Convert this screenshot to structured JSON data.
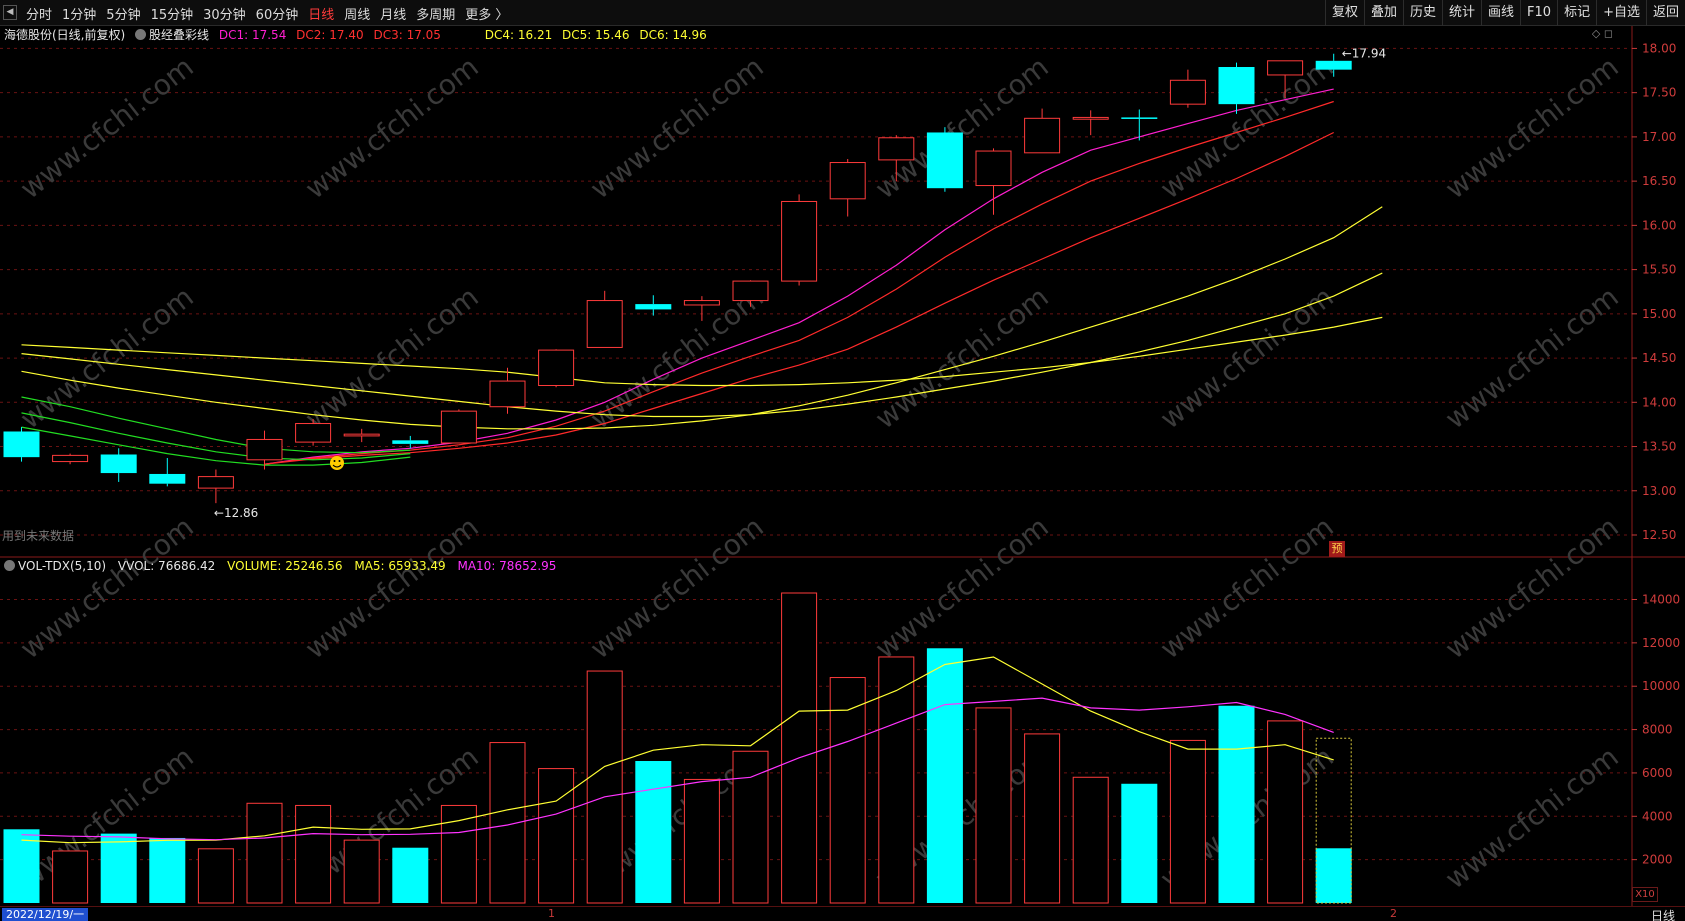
{
  "toolbar": {
    "left_arrow": "◀",
    "periods": [
      "分时",
      "1分钟",
      "5分钟",
      "15分钟",
      "30分钟",
      "60分钟",
      "日线",
      "周线",
      "月线",
      "多周期",
      "更多 〉"
    ],
    "active_period": "日线",
    "tools": [
      "复权",
      "叠加",
      "历史",
      "统计",
      "画线",
      "F10",
      "标记",
      "+自选",
      "返回"
    ]
  },
  "kline_header": {
    "stock": "海德股份(日线,前复权)",
    "indicator": "股经叠彩线",
    "dc1": "DC1: 17.54",
    "dc2": "DC2: 17.40",
    "dc3": "DC3: 17.05",
    "dc4": "DC4: 16.21",
    "dc5": "DC5: 15.46",
    "dc6": "DC6: 14.96",
    "right_icons": "◇ ◻"
  },
  "volume_header": {
    "name": "VOL-TDX(5,10)",
    "vvol": "VVOL: 76686.42",
    "volume": "VOLUME: 25246.56",
    "ma5": "MA5: 65933.49",
    "ma10": "MA10: 78652.95"
  },
  "labels": {
    "high_label": "17.94",
    "low_label": "12.86",
    "future_note": "用到未来数据",
    "yu_badge": "预",
    "scale_badge": "X10",
    "date_cursor": "2022/12/19/一",
    "mode": "日线",
    "xticks": [
      "1",
      "2"
    ]
  },
  "colors": {
    "up": "#ff3b3b",
    "down": "#00ffff",
    "dc1": "#ff1fd0",
    "dc2": "#ff2a2a",
    "dc3": "#ff2a2a",
    "dc4": "#ffff33",
    "dc5": "#ffff33",
    "dc6": "#ffff33",
    "green": "#22dd22",
    "ma5": "#ffff33",
    "ma10": "#ff33ff",
    "grid": "#6a1212"
  },
  "chart_data": [
    {
      "type": "candlestick",
      "title": "海德股份(日线,前复权)",
      "y_ticks": [
        12.5,
        13.0,
        13.5,
        14.0,
        14.5,
        15.0,
        15.5,
        16.0,
        16.5,
        17.0,
        17.5,
        18.0
      ],
      "ylim": [
        12.3,
        18.1
      ],
      "candles": [
        {
          "o": 13.67,
          "h": 13.72,
          "l": 13.33,
          "c": 13.38,
          "dir": "down"
        },
        {
          "o": 13.33,
          "h": 13.42,
          "l": 13.3,
          "c": 13.4,
          "dir": "up"
        },
        {
          "o": 13.41,
          "h": 13.48,
          "l": 13.1,
          "c": 13.2,
          "dir": "down"
        },
        {
          "o": 13.19,
          "h": 13.37,
          "l": 13.05,
          "c": 13.08,
          "dir": "down"
        },
        {
          "o": 13.03,
          "h": 13.24,
          "l": 12.86,
          "c": 13.16,
          "dir": "up"
        },
        {
          "o": 13.35,
          "h": 13.68,
          "l": 13.24,
          "c": 13.58,
          "dir": "up"
        },
        {
          "o": 13.55,
          "h": 13.81,
          "l": 13.51,
          "c": 13.76,
          "dir": "up"
        },
        {
          "o": 13.62,
          "h": 13.7,
          "l": 13.55,
          "c": 13.64,
          "dir": "up"
        },
        {
          "o": 13.57,
          "h": 13.62,
          "l": 13.48,
          "c": 13.53,
          "dir": "down"
        },
        {
          "o": 13.54,
          "h": 13.92,
          "l": 13.54,
          "c": 13.9,
          "dir": "up"
        },
        {
          "o": 13.95,
          "h": 14.39,
          "l": 13.87,
          "c": 14.24,
          "dir": "up"
        },
        {
          "o": 14.19,
          "h": 14.6,
          "l": 14.17,
          "c": 14.59,
          "dir": "up"
        },
        {
          "o": 14.62,
          "h": 15.26,
          "l": 14.62,
          "c": 15.15,
          "dir": "up"
        },
        {
          "o": 15.11,
          "h": 15.21,
          "l": 14.98,
          "c": 15.05,
          "dir": "down"
        },
        {
          "o": 15.1,
          "h": 15.2,
          "l": 14.92,
          "c": 15.15,
          "dir": "up"
        },
        {
          "o": 15.15,
          "h": 15.38,
          "l": 15.08,
          "c": 15.37,
          "dir": "up"
        },
        {
          "o": 15.37,
          "h": 16.35,
          "l": 15.32,
          "c": 16.27,
          "dir": "up"
        },
        {
          "o": 16.3,
          "h": 16.75,
          "l": 16.1,
          "c": 16.71,
          "dir": "up"
        },
        {
          "o": 16.74,
          "h": 17.02,
          "l": 16.5,
          "c": 16.99,
          "dir": "up"
        },
        {
          "o": 17.05,
          "h": 17.11,
          "l": 16.38,
          "c": 16.42,
          "dir": "down"
        },
        {
          "o": 16.45,
          "h": 16.87,
          "l": 16.12,
          "c": 16.84,
          "dir": "up"
        },
        {
          "o": 16.82,
          "h": 17.32,
          "l": 16.82,
          "c": 17.21,
          "dir": "up"
        },
        {
          "o": 17.2,
          "h": 17.3,
          "l": 17.02,
          "c": 17.22,
          "dir": "up"
        },
        {
          "o": 17.22,
          "h": 17.31,
          "l": 16.96,
          "c": 17.21,
          "dir": "down"
        },
        {
          "o": 17.37,
          "h": 17.76,
          "l": 17.33,
          "c": 17.64,
          "dir": "up"
        },
        {
          "o": 17.79,
          "h": 17.84,
          "l": 17.26,
          "c": 17.37,
          "dir": "down"
        },
        {
          "o": 17.7,
          "h": 17.86,
          "l": 17.44,
          "c": 17.86,
          "dir": "up"
        },
        {
          "o": 17.86,
          "h": 17.94,
          "l": 17.68,
          "c": 17.76,
          "dir": "down"
        }
      ],
      "series": [
        {
          "name": "DC1",
          "color": "#ff1fd0",
          "start": 5,
          "values": [
            13.3,
            13.38,
            13.44,
            13.48,
            13.55,
            13.65,
            13.8,
            14.0,
            14.26,
            14.5,
            14.7,
            14.9,
            15.2,
            15.55,
            15.95,
            16.3,
            16.6,
            16.85,
            17.0,
            17.15,
            17.3,
            17.42,
            17.54
          ]
        },
        {
          "name": "DC2",
          "color": "#ff2a2a",
          "start": 5,
          "values": [
            13.3,
            13.37,
            13.42,
            13.46,
            13.52,
            13.6,
            13.73,
            13.9,
            14.12,
            14.33,
            14.52,
            14.7,
            14.96,
            15.28,
            15.64,
            15.96,
            16.24,
            16.5,
            16.7,
            16.88,
            17.05,
            17.22,
            17.4
          ]
        },
        {
          "name": "DC3",
          "color": "#ff2a2a",
          "start": 5,
          "values": [
            13.3,
            13.36,
            13.4,
            13.43,
            13.48,
            13.54,
            13.63,
            13.76,
            13.93,
            14.1,
            14.27,
            14.42,
            14.6,
            14.85,
            15.12,
            15.38,
            15.62,
            15.86,
            16.08,
            16.3,
            16.53,
            16.78,
            17.05
          ]
        },
        {
          "name": "DC4",
          "color": "#ffff33",
          "start": 0,
          "values": [
            14.35,
            14.25,
            14.16,
            14.08,
            14.0,
            13.93,
            13.86,
            13.8,
            13.75,
            13.72,
            13.7,
            13.7,
            13.71,
            13.74,
            13.79,
            13.86,
            13.96,
            14.08,
            14.22,
            14.37,
            14.52,
            14.68,
            14.85,
            15.02,
            15.2,
            15.4,
            15.62,
            15.86,
            16.21
          ]
        },
        {
          "name": "DC5",
          "color": "#ffff33",
          "start": 0,
          "values": [
            14.55,
            14.49,
            14.43,
            14.37,
            14.31,
            14.25,
            14.19,
            14.13,
            14.07,
            14.01,
            13.95,
            13.9,
            13.86,
            13.84,
            13.84,
            13.86,
            13.91,
            13.98,
            14.06,
            14.15,
            14.24,
            14.34,
            14.45,
            14.57,
            14.7,
            14.85,
            15.0,
            15.2,
            15.46
          ]
        },
        {
          "name": "DC6",
          "color": "#ffff33",
          "start": 0,
          "values": [
            14.65,
            14.62,
            14.59,
            14.56,
            14.53,
            14.5,
            14.47,
            14.44,
            14.41,
            14.38,
            14.34,
            14.28,
            14.22,
            14.2,
            14.19,
            14.19,
            14.2,
            14.22,
            14.25,
            14.29,
            14.34,
            14.39,
            14.45,
            14.52,
            14.6,
            14.68,
            14.76,
            14.85,
            14.96
          ]
        },
        {
          "name": "G1",
          "color": "#22dd22",
          "start": 0,
          "values": [
            14.06,
            13.95,
            13.82,
            13.7,
            13.58,
            13.48,
            13.44,
            13.43,
            13.46
          ]
        },
        {
          "name": "G2",
          "color": "#22dd22",
          "start": 0,
          "values": [
            13.88,
            13.77,
            13.65,
            13.54,
            13.44,
            13.37,
            13.35,
            13.37,
            13.42
          ]
        },
        {
          "name": "G3",
          "color": "#22dd22",
          "start": 0,
          "values": [
            13.72,
            13.62,
            13.52,
            13.42,
            13.34,
            13.29,
            13.29,
            13.32,
            13.38
          ]
        }
      ]
    },
    {
      "type": "bar",
      "title": "VOL-TDX(5,10)",
      "y_ticks": [
        2000,
        4000,
        6000,
        8000,
        10000,
        12000,
        14000
      ],
      "ylim": [
        0,
        14800
      ],
      "values": [
        3400,
        2400,
        3200,
        3000,
        2500,
        4600,
        4500,
        2900,
        2550,
        4500,
        7400,
        6200,
        10700,
        6550,
        5700,
        7000,
        14300,
        10400,
        11350,
        11750,
        9000,
        7800,
        5800,
        5500,
        7500,
        9100,
        8400,
        2524
      ],
      "dirs": [
        "down",
        "up",
        "down",
        "down",
        "up",
        "up",
        "up",
        "up",
        "down",
        "up",
        "up",
        "up",
        "up",
        "down",
        "up",
        "up",
        "up",
        "up",
        "up",
        "down",
        "up",
        "up",
        "up",
        "down",
        "up",
        "down",
        "up",
        "down"
      ],
      "estimate_last": 7600,
      "ma5": [
        2900,
        2780,
        2820,
        2890,
        2900,
        3100,
        3500,
        3400,
        3420,
        3800,
        4300,
        4700,
        6300,
        7050,
        7300,
        7250,
        8850,
        8900,
        9800,
        11000,
        11350,
        10100,
        8850,
        7900,
        7100,
        7100,
        7300,
        6600
      ],
      "ma10": [
        3150,
        3080,
        3050,
        2960,
        2920,
        3000,
        3200,
        3150,
        3170,
        3250,
        3600,
        4100,
        4900,
        5250,
        5600,
        5800,
        6700,
        7450,
        8300,
        9150,
        9300,
        9450,
        9000,
        8900,
        9050,
        9250,
        8700,
        7870
      ]
    }
  ]
}
